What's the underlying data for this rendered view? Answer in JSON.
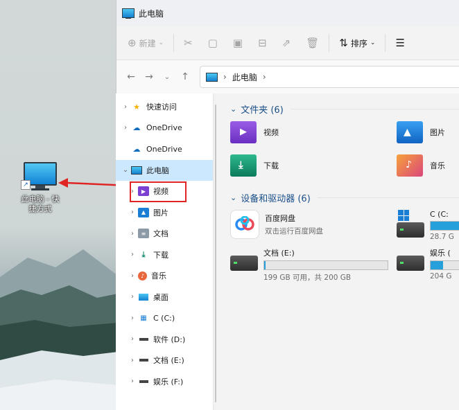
{
  "desktop": {
    "shortcut_label_line1": "此电脑 - 快",
    "shortcut_label_line2": "捷方式"
  },
  "window": {
    "title": "此电脑"
  },
  "toolbar": {
    "new_label": "新建",
    "sort_label": "排序"
  },
  "address": {
    "location": "此电脑"
  },
  "nav": {
    "items": [
      {
        "label": "快速访问",
        "icon": "star-icon"
      },
      {
        "label": "OneDrive",
        "icon": "cloud-icon"
      },
      {
        "label": "OneDrive",
        "icon": "cloud-icon"
      },
      {
        "label": "此电脑",
        "icon": "computer-icon"
      },
      {
        "label": "视频",
        "icon": "video-icon"
      },
      {
        "label": "图片",
        "icon": "image-icon"
      },
      {
        "label": "文档",
        "icon": "document-icon"
      },
      {
        "label": "下载",
        "icon": "download-icon"
      },
      {
        "label": "音乐",
        "icon": "music-icon"
      },
      {
        "label": "桌面",
        "icon": "desktop-icon"
      },
      {
        "label": "C (C:)",
        "icon": "windows-drive-icon"
      },
      {
        "label": "软件 (D:)",
        "icon": "drive-icon"
      },
      {
        "label": "文档 (E:)",
        "icon": "drive-icon"
      },
      {
        "label": "娱乐 (F:)",
        "icon": "drive-icon"
      }
    ]
  },
  "folders_section": {
    "header": "文件夹 (6)",
    "items": [
      {
        "label": "视频"
      },
      {
        "label": "图片"
      },
      {
        "label": "下载"
      },
      {
        "label": "音乐"
      }
    ]
  },
  "drives_section": {
    "header": "设备和驱动器 (6)",
    "baidu": {
      "name": "百度网盘",
      "sub": "双击运行百度网盘"
    },
    "c_drive": {
      "name": "C (C:",
      "space": "28.7 G",
      "fill_percent": 86
    },
    "e_drive": {
      "name": "文档 (E:)",
      "space": "199 GB 可用，共 200 GB",
      "fill_percent": 1
    },
    "f_drive": {
      "name": "娱乐 (",
      "space": "204 G",
      "fill_percent": 30
    }
  },
  "colors": {
    "accent": "#26a0da",
    "selection": "#cce8ff",
    "highlight": "#e02424"
  }
}
